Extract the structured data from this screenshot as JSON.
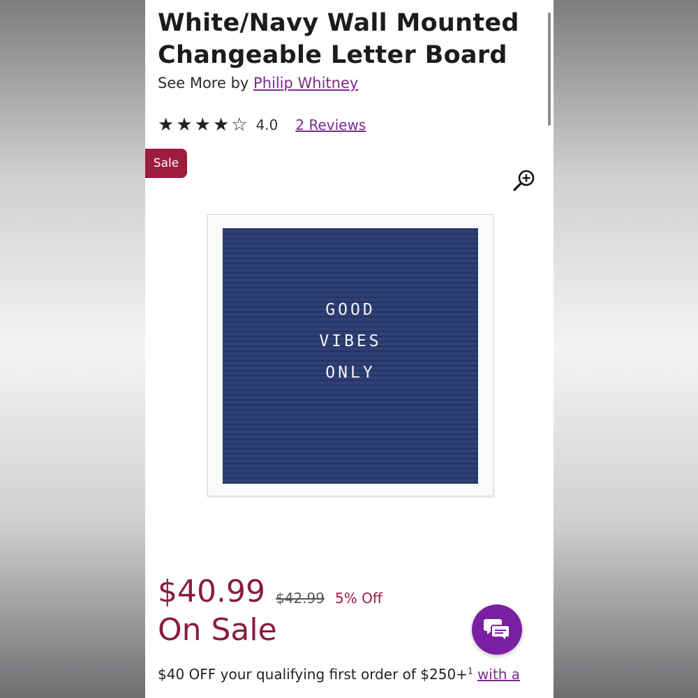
{
  "product": {
    "title": "White/Navy Wall Mounted Changeable Letter Board",
    "by_prefix": "See More by",
    "brand": "Philip Whitney",
    "rating": 4,
    "rating_text": "4.0",
    "reviews_link": "2 Reviews",
    "badge": "Sale",
    "image_text": [
      "GOOD",
      "VIBES",
      "ONLY"
    ]
  },
  "pricing": {
    "current": "$40.99",
    "original": "$42.99",
    "discount": "5% Off",
    "status": "On Sale"
  },
  "promo": {
    "text": "$40 OFF your qualifying first order of $250+",
    "footnote": "1",
    "link": "with a"
  },
  "icons": {
    "zoom": "zoom-in-icon",
    "chat": "chat-bubbles-icon",
    "star_full": "star-filled-icon",
    "star_empty": "star-outline-icon"
  },
  "colors": {
    "accent_purple": "#7b2a8e",
    "price_red": "#8a1c3c",
    "sale_badge": "#9c1b3f",
    "chat_button": "#7b1fa2",
    "board_navy": "#2a3a6c"
  }
}
